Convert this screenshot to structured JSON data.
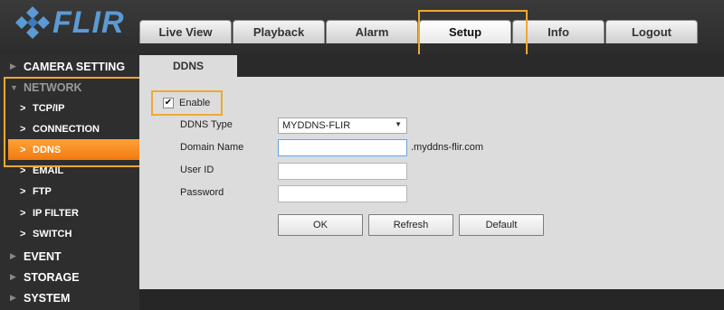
{
  "brand": {
    "name": "FLIR",
    "accent": "#5b9bd5"
  },
  "tabs": [
    {
      "label": "Live View"
    },
    {
      "label": "Playback"
    },
    {
      "label": "Alarm"
    },
    {
      "label": "Setup"
    },
    {
      "label": "Info"
    },
    {
      "label": "Logout"
    }
  ],
  "active_tab": "Setup",
  "sidebar": {
    "items": [
      {
        "label": "CAMERA SETTING",
        "type": "category",
        "expanded": false
      },
      {
        "label": "NETWORK",
        "type": "category",
        "expanded": true
      },
      {
        "label": "TCP/IP",
        "type": "sub"
      },
      {
        "label": "CONNECTION",
        "type": "sub"
      },
      {
        "label": "DDNS",
        "type": "sub",
        "selected": true
      },
      {
        "label": "EMAIL",
        "type": "sub"
      },
      {
        "label": "FTP",
        "type": "sub"
      },
      {
        "label": "IP FILTER",
        "type": "sub"
      },
      {
        "label": "SWITCH",
        "type": "sub"
      },
      {
        "label": "EVENT",
        "type": "category",
        "expanded": false
      },
      {
        "label": "STORAGE",
        "type": "category",
        "expanded": false
      },
      {
        "label": "SYSTEM",
        "type": "category",
        "expanded": false
      }
    ],
    "selected_color": "#f58b1f"
  },
  "page": {
    "tab_label": "DDNS",
    "enable": {
      "label": "Enable",
      "checked": true
    },
    "fields": {
      "ddns_type": {
        "label": "DDNS Type",
        "value": "MYDDNS-FLIR"
      },
      "domain_name": {
        "label": "Domain Name",
        "value": "",
        "suffix": ".myddns-flir.com"
      },
      "user_id": {
        "label": "User ID",
        "value": ""
      },
      "password": {
        "label": "Password",
        "value": ""
      }
    },
    "buttons": {
      "ok": "OK",
      "refresh": "Refresh",
      "default": "Default"
    }
  },
  "highlight_color": "#f0a930"
}
